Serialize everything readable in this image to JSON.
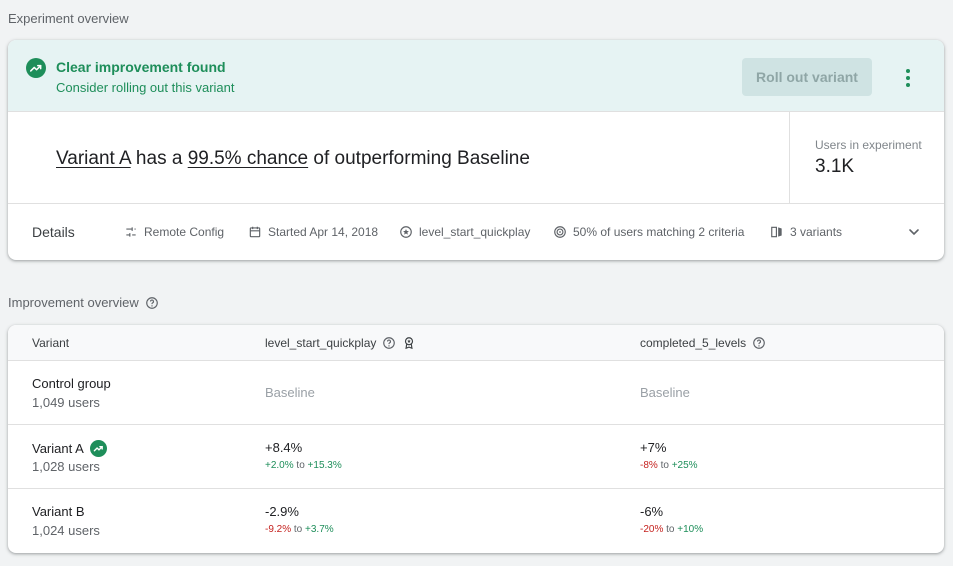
{
  "sections": {
    "experiment_overview": "Experiment overview",
    "improvement_overview": "Improvement overview"
  },
  "banner": {
    "title": "Clear improvement found",
    "subtitle": "Consider rolling out this variant",
    "rollout_label": "Roll out variant",
    "icon": "trending-up-icon",
    "color": "#1e8e5a"
  },
  "headline": {
    "variant": "Variant A",
    "has_a": " has a ",
    "chance": "99.5% chance",
    "rest": " of outperforming Baseline"
  },
  "users": {
    "label": "Users in experiment",
    "value": "3.1K"
  },
  "details": {
    "label": "Details",
    "remote_config": "Remote Config",
    "started": "Started Apr 14, 2018",
    "goal": "level_start_quickplay",
    "targeting": "50% of users matching 2 criteria",
    "variants": "3 variants"
  },
  "table": {
    "headers": [
      "Variant",
      "level_start_quickplay",
      "completed_5_levels"
    ],
    "rows": [
      {
        "name": "Control group",
        "users": "1,049 users",
        "m1": "Baseline",
        "m2": "Baseline"
      },
      {
        "name": "Variant A",
        "users": "1,028 users",
        "m1": "+8.4%",
        "m1_lo": "+2.0%",
        "m1_to": " to ",
        "m1_hi": "+15.3%",
        "m2": "+7%",
        "m2_lo": "-8%",
        "m2_to": " to ",
        "m2_hi": "+25%"
      },
      {
        "name": "Variant B",
        "users": "1,024 users",
        "m1": "-2.9%",
        "m1_lo": "-9.2%",
        "m1_to": " to ",
        "m1_hi": "+3.7%",
        "m2": "-6%",
        "m2_lo": "-20%",
        "m2_to": " to ",
        "m2_hi": "+10%"
      }
    ]
  },
  "colors": {
    "positive": "#1e8e5a",
    "negative": "#c5221f",
    "banner_bg": "#e6f3f3"
  }
}
